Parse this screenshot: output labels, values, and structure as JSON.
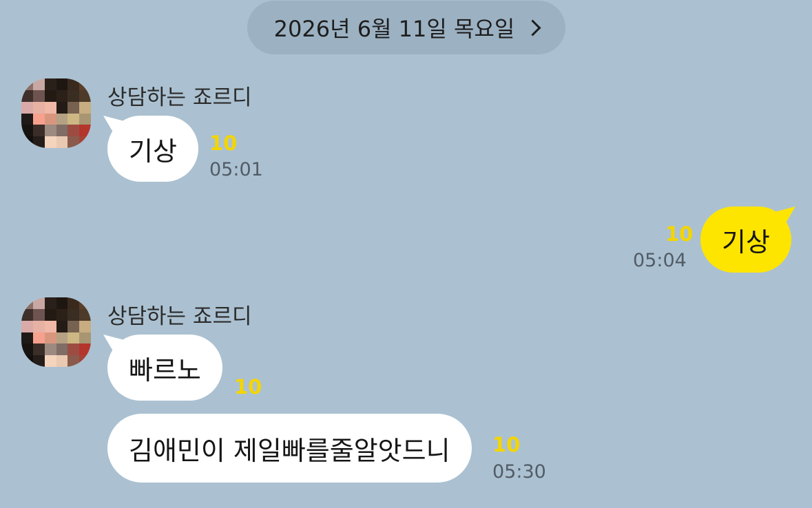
{
  "date_header": {
    "label": "2026년 6월 11일 목요일",
    "chevron_icon": "chevron-right-icon"
  },
  "colors": {
    "background": "#abc1d1",
    "my_bubble": "#fee500",
    "their_bubble": "#ffffff",
    "unread_count": "#f4d500"
  },
  "messages": [
    {
      "sender": "상담하는 죠르디",
      "text": "기상",
      "unread": "10",
      "time": "05:01",
      "side": "received"
    },
    {
      "text": "기상",
      "unread": "10",
      "time": "05:04",
      "side": "sent"
    },
    {
      "sender": "상담하는 죠르디",
      "text": "빠르노",
      "unread": "10",
      "side": "received"
    },
    {
      "text": "김애민이 제일빠를줄알앗드니",
      "unread": "10",
      "time": "05:30",
      "side": "received"
    }
  ]
}
